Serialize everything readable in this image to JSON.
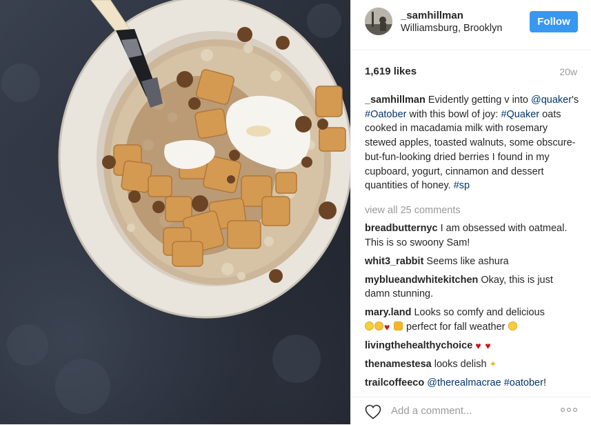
{
  "post": {
    "image": {
      "subject": "oatmeal-bowl-photo"
    },
    "header": {
      "username": "_samhillman",
      "location": "Williamsburg, Brooklyn",
      "follow_label": "Follow",
      "follow_color": "#3897f0"
    },
    "likes": "1,619 likes",
    "time_ago": "20w",
    "caption": {
      "username": "_samhillman",
      "t1": " Evidently getting v into ",
      "mention_quaker": "@quaker",
      "t2": "'s ",
      "tag_oatober": "#Oatober",
      "t3": " with this bowl of joy: ",
      "tag_quaker": "#Quaker",
      "t4": " oats cooked in macadamia milk with rosemary stewed apples, toasted walnuts, some obscure-but-fun-looking dried berries I found in my cupboard, yogurt, cinnamon and dessert quantities of honey. ",
      "tag_sp": "#sp"
    },
    "view_all_comments": "view all 25 comments",
    "comments": [
      {
        "user": "breadbutternyc",
        "text": " I am obsessed with oatmeal. This is so swoony Sam!"
      },
      {
        "user": "whit3_rabbit",
        "text": " Seems like ashura"
      },
      {
        "user": "myblueandwhitekitchen",
        "text": " Okay, this is just damn stunning."
      },
      {
        "user": "mary.land",
        "text": " Looks so comfy and delicious ",
        "text2": " perfect for fall weather ",
        "emojis": [
          "smile-emoji",
          "heart-eyes-emoji",
          "red-heart-emoji",
          "clapping-hands-emoji",
          "smile-emoji"
        ]
      },
      {
        "user": "livingthehealthychoice",
        "text": " ",
        "emojis": [
          "red-heart-emoji",
          "red-heart-emoji"
        ]
      },
      {
        "user": "thenamestesa",
        "text": " looks delish ",
        "emojis": [
          "sparkles-emoji"
        ]
      },
      {
        "user": "trailcoffeeco",
        "mention": "@therealmacrae",
        "tag": "#oatober",
        "text_end": "!"
      }
    ],
    "add_comment_placeholder": "Add a comment...",
    "icons": {
      "like": "heart-outline-icon",
      "more": "more-options-icon"
    },
    "colors": {
      "link": "#003569",
      "muted": "#999999",
      "text": "#262626"
    }
  }
}
